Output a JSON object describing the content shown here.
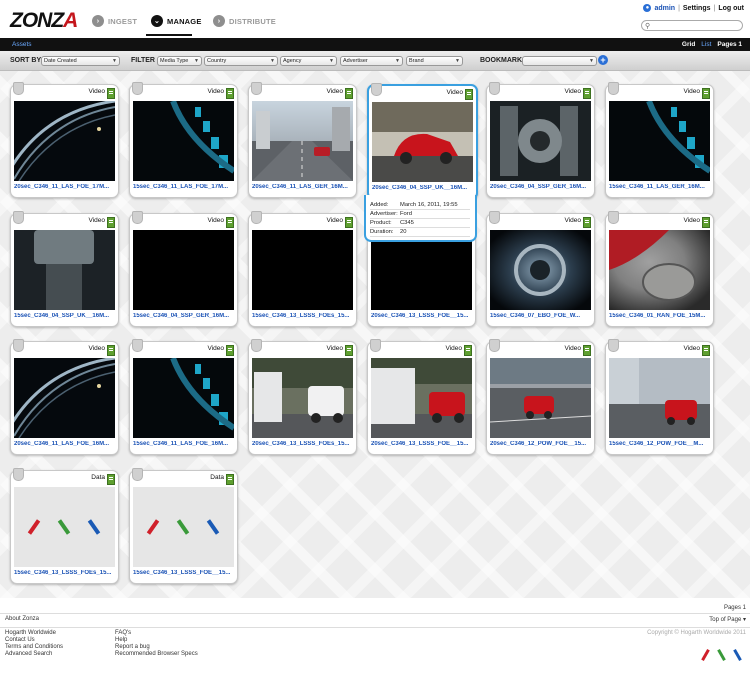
{
  "header": {
    "logo": "ZONZA",
    "nav": [
      {
        "label": "INGEST",
        "active": false
      },
      {
        "label": "MANAGE",
        "active": true
      },
      {
        "label": "DISTRIBUTE",
        "active": false
      }
    ],
    "user": "admin",
    "settings": "Settings",
    "logout": "Log out",
    "search_placeholder": ""
  },
  "subbar": {
    "assets_link": "Assets",
    "grid_label": "Grid",
    "list_label": "List",
    "pages_label": "Pages 1"
  },
  "filters": {
    "sort_by_label": "SORT BY",
    "sort_value": "Date Created",
    "filter_label": "FILTER",
    "media_type": "Media Type",
    "country": "Country",
    "agency": "Agency",
    "advertiser": "Advertiser",
    "brand": "Brand",
    "bookmarks_label": "BOOKMARKS",
    "bookmarks_value": ""
  },
  "assets": [
    {
      "type": "Video",
      "title": "20sec_C346_11_LAS_FOE_17M..."
    },
    {
      "type": "Video",
      "title": "15sec_C346_11_LAS_FOE_17M..."
    },
    {
      "type": "Video",
      "title": "20sec_C346_11_LAS_GER_16M..."
    },
    {
      "type": "Video",
      "title": "20sec_C346_04_SSP_UK__16M..."
    },
    {
      "type": "Video",
      "title": "20sec_C346_04_SSP_GER_16M..."
    },
    {
      "type": "Video",
      "title": "15sec_C346_11_LAS_GER_16M..."
    },
    {
      "type": "Video",
      "title": "15sec_C346_04_SSP_UK__16M..."
    },
    {
      "type": "Video",
      "title": "15sec_C346_04_SSP_GER_16M..."
    },
    {
      "type": "Video",
      "title": "15sec_C346_13_LSSS_FOEs_15..."
    },
    {
      "type": "Video",
      "title": "20sec_C346_13_LSSS_FOE__15..."
    },
    {
      "type": "Video",
      "title": "15sec_C346_07_EBO_FOE_W..."
    },
    {
      "type": "Video",
      "title": "15sec_C346_01_RAN_FOE_15M..."
    },
    {
      "type": "Video",
      "title": "20sec_C346_11_LAS_FOE_16M..."
    },
    {
      "type": "Video",
      "title": "15sec_C346_11_LAS_FOE_16M..."
    },
    {
      "type": "Video",
      "title": "20sec_C346_13_LSSS_FOEs_15..."
    },
    {
      "type": "Video",
      "title": "20sec_C346_13_LSSS_FOE__15..."
    },
    {
      "type": "Video",
      "title": "20sec_C346_12_POW_FOE__15..."
    },
    {
      "type": "Video",
      "title": "15sec_C346_12_POW_FOE__M..."
    },
    {
      "type": "Data",
      "title": "15sec_C346_13_LSSS_FOEs_15..."
    },
    {
      "type": "Data",
      "title": "15sec_C346_13_LSSS_FOE__15..."
    }
  ],
  "hover_details": {
    "added_label": "Added:",
    "added_value": "March 16, 2011, 19:55",
    "advertiser_label": "Advertiser:",
    "advertiser_value": "Ford",
    "product_label": "Product:",
    "product_value": "C345",
    "duration_label": "Duration:",
    "duration_value": "20"
  },
  "footer": {
    "about": "About Zonza",
    "pages": "Pages 1",
    "top_of_page": "Top of Page",
    "col1": [
      "Hogarth Worldwide",
      "Contact Us",
      "Terms and Conditions",
      "Advanced Search"
    ],
    "col2": [
      "FAQ's",
      "Help",
      "Report a bug",
      "Recommended Browser Specs"
    ],
    "copyright": "Copyright © Hogarth Worldwide 2011"
  },
  "colors": {
    "accent_blue": "#1a52b5",
    "selected_border": "#3aa0e0",
    "stripe_red": "#d0202a",
    "stripe_green": "#3a9a3a",
    "stripe_blue": "#1a5ab5"
  }
}
